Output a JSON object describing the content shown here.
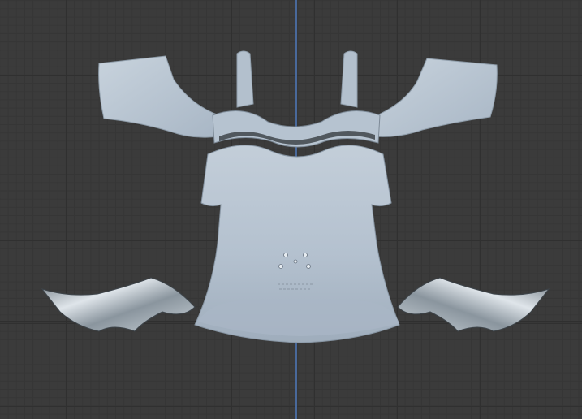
{
  "viewport": {
    "mode": "3d-viewport",
    "background_color": "#3b3b3b",
    "grid_line_color": "#303030",
    "z_axis_color": "#4b6fa6"
  },
  "model": {
    "object": "garment-top",
    "shirt_color": "#b9c6d3",
    "shirt_shadow_color": "#93a2b2",
    "arm_piece_color": "#8d99a3",
    "arm_piece_highlight_color": "#e2e8ec"
  }
}
